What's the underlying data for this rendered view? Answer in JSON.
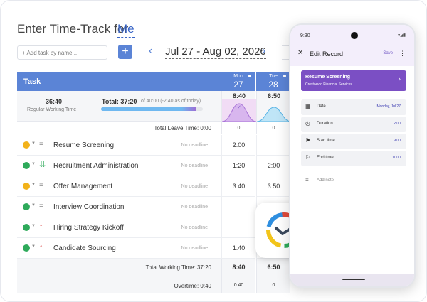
{
  "header": {
    "title": "Enter Time-Track for",
    "user": "Me"
  },
  "toolbar": {
    "add_placeholder": "+ Add task by name...",
    "add_icon": "+",
    "prev_icon": "‹",
    "next_icon": "›",
    "date_range": "Jul 27 - Aug 02, 2026"
  },
  "table": {
    "task_header": "Task",
    "days": [
      {
        "name": "Mon",
        "date": "27",
        "total": "8:40",
        "leave": "0",
        "progress_pct": 100
      },
      {
        "name": "Tue",
        "date": "28",
        "total": "6:50",
        "leave": "0",
        "progress_pct": 80
      }
    ],
    "summary": {
      "regular_time": "36:40",
      "regular_label": "Regular Working Time",
      "total": "Total: 37:20",
      "of_text": "of 40:00 (-2:40 as of today)",
      "progress_pct": 93
    },
    "leave_label": "Total Leave Time: 0:00",
    "rows": [
      {
        "name": "Resume Screening",
        "deadline": "No deadline",
        "clock_color": "#f2b21a",
        "priority": "=",
        "priority_color": "#888888",
        "mon": "2:00",
        "tue": ""
      },
      {
        "name": "Recruitment Administration",
        "deadline": "No deadline",
        "clock_color": "#2eaa5a",
        "priority": "⇊",
        "priority_color": "#2eaa5a",
        "mon": "1:20",
        "tue": "2:00"
      },
      {
        "name": "Offer Management",
        "deadline": "No deadline",
        "clock_color": "#f2b21a",
        "priority": "=",
        "priority_color": "#888888",
        "mon": "3:40",
        "tue": "3:50"
      },
      {
        "name": "Interview Coordination",
        "deadline": "No deadline",
        "clock_color": "#2eaa5a",
        "priority": "=",
        "priority_color": "#888888",
        "mon": "",
        "tue": ""
      },
      {
        "name": "Hiring Strategy Kickoff",
        "deadline": "No deadline",
        "clock_color": "#2eaa5a",
        "priority": "↑",
        "priority_color": "#d63a3a",
        "mon": "",
        "tue": ""
      },
      {
        "name": "Candidate Sourcing",
        "deadline": "No deadline",
        "clock_color": "#2eaa5a",
        "priority": "↑",
        "priority_color": "#d63a3a",
        "mon": "1:40",
        "tue": ""
      }
    ],
    "total_working": {
      "label": "Total Working Time: 37:20",
      "mon": "8:40",
      "tue": "6:50"
    },
    "overtime": {
      "label": "Overtime: 0:40",
      "mon": "0:40",
      "tue": "0"
    }
  },
  "phone": {
    "time": "9:30",
    "status_icons": "▾◢▮",
    "close_icon": "✕",
    "title": "Edit Record",
    "save": "Save",
    "more_icon": "⋮",
    "task_name": "Resume Screening",
    "client": "Crestwood Financial Services",
    "task_arrow": "›",
    "fields": [
      {
        "icon": "▦",
        "label": "Date",
        "value": "Monday, Jul 27"
      },
      {
        "icon": "◷",
        "label": "Duration",
        "value": "2:00"
      },
      {
        "icon": "⚑",
        "label": "Start time",
        "value": "9:00"
      },
      {
        "icon": "⚐",
        "label": "End time",
        "value": "11:00"
      }
    ],
    "note_icon": "≡",
    "note": "Add note"
  },
  "colors": {
    "accent": "#5b84d6",
    "purple": "#7b4fc4",
    "green": "#2eaa5a",
    "yellow": "#f2b21a",
    "red": "#d63a3a"
  }
}
